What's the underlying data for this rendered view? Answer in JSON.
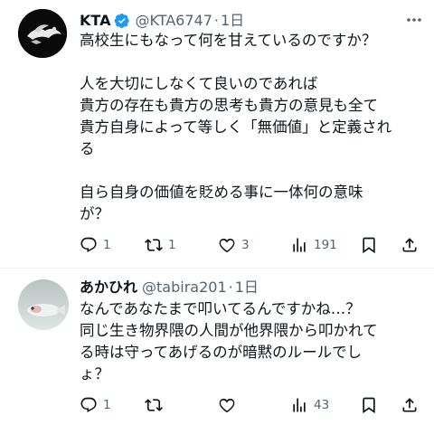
{
  "tweets": [
    {
      "name": "KTA",
      "handle": "@KTA6747",
      "separator": "·",
      "time": "1日",
      "verified": true,
      "body": "高校生にもなって何を甘えているのですか？\n\n人を大切にしなくて良いのであれば\n貴方の存在も貴方の思考も貴方の意見も全て\n貴方自身によって等しく「無価値」と定義され\nる\n\n自ら自身の価値を貶める事に一体何の意味\nが？",
      "replies": "1",
      "reposts": "1",
      "likes": "3",
      "views": "191"
    },
    {
      "name": "あかひれ",
      "handle": "@tabira201",
      "separator": "·",
      "time": "1日",
      "verified": false,
      "body": "なんであなたまで叩いてるんですかね…？\n同じ生き物界隈の人間が他界隈から叩かれて\nる時は守ってあげるのが暗黙のルールでし\nょ？",
      "replies": "1",
      "reposts": "",
      "likes": "",
      "views": "43"
    }
  ],
  "colors": {
    "text": "#0f1419",
    "secondary": "#536471",
    "verified_blue": "#1d9bf0",
    "divider": "#eff3f4"
  },
  "icons": [
    "verified-badge-icon",
    "more-icon",
    "reply-icon",
    "repost-icon",
    "like-icon",
    "views-icon",
    "bookmark-icon",
    "share-icon"
  ]
}
